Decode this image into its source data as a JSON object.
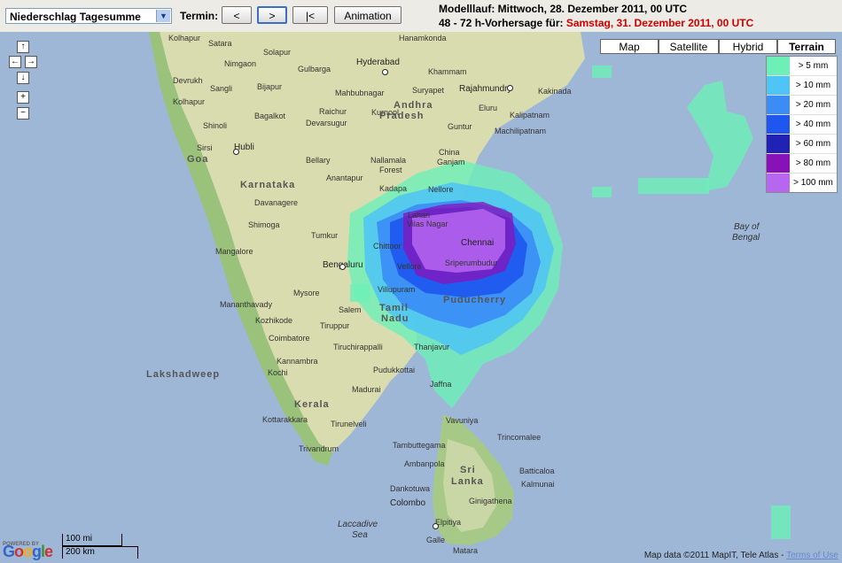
{
  "toolbar": {
    "product_select": "Niederschlag Tagesumme",
    "termin_label": "Termin:",
    "prev_btn": "<",
    "next_btn": ">",
    "first_btn": "|<",
    "animation_btn": "Animation"
  },
  "run_info": {
    "modelllauf": "Modelllauf: Mittwoch, 28. Dezember 2011, 00 UTC",
    "forecast_prefix": "48 - 72 h-Vorhersage für:",
    "forecast_time": "Samstag, 31. Dezember 2011, 00 UTC"
  },
  "map_types": [
    "Map",
    "Satellite",
    "Hybrid",
    "Terrain"
  ],
  "selected_map_type": "Terrain",
  "legend": [
    {
      "label": "> 5 mm",
      "color": "#6cf0b8"
    },
    {
      "label": "> 10 mm",
      "color": "#4fc4f7"
    },
    {
      "label": "> 20 mm",
      "color": "#3b8cf5"
    },
    {
      "label": "> 40 mm",
      "color": "#1e56f0"
    },
    {
      "label": "> 60 mm",
      "color": "#1f22b4"
    },
    {
      "label": "> 80 mm",
      "color": "#8812b8"
    },
    {
      "label": "> 100 mm",
      "color": "#b766f0"
    }
  ],
  "labels": {
    "kolhapur": "Kolhapur",
    "solapur": "Solapur",
    "gulbarga": "Gulbarga",
    "nimgaon": "Nimgaon",
    "satara": "Satara",
    "hyderabad": "Hyderabad",
    "hanamkonda": "Hanamkonda",
    "khammam": "Khammam",
    "devrukh": "Devrukh",
    "sangli": "Sangli",
    "bijapur": "Bijapur",
    "mahbubnagar": "Mahbubnagar",
    "suryapet": "Suryapet",
    "rajahmundry": "Rajahmundry",
    "kakinada": "Kakinada",
    "eluru": "Eluru",
    "bagalkot": "Bagalkot",
    "raichur": "Raichur",
    "devarsugur": "Devarsugur",
    "kurnool": "Kurnool",
    "andhra": "Andhra",
    "pradesh": "Pradesh",
    "kalipatnam": "Kalipatnam",
    "machilipatnam": "Machilipatnam",
    "guntur": "Guntur",
    "shinoli": "Shinoli",
    "hubli": "Hubli",
    "sirsi": "Sirsi",
    "goa": "Goa",
    "bellary": "Bellary",
    "nallamala": "Nallamala",
    "forest": "Forest",
    "china": "China",
    "ganjam": "Ganjam",
    "karnataka": "Karnataka",
    "anantapur": "Anantapur",
    "kadapa": "Kadapa",
    "nellore": "Nellore",
    "davanagere": "Davanagere",
    "shimoga": "Shimoga",
    "lahari": "Lahari",
    "vilas_nagar": "Vilas Nagar",
    "chennai": "Chennai",
    "tumkur": "Tumkur",
    "chittoor": "Chittoor",
    "mangalore": "Mangalore",
    "bengaluru": "Bengaluru",
    "vellore": "Vellore",
    "sriperumbudur": "Sriperumbudur",
    "bay_of": "Bay of",
    "bengal": "Bengal",
    "mysore": "Mysore",
    "villupuram": "Villupuram",
    "puducherry": "Puducherry",
    "mananthavady": "Mananthavady",
    "salem": "Salem",
    "tamil": "Tamil",
    "nadu": "Nadu",
    "kozhikode": "Kozhikode",
    "tiruppur": "Tiruppur",
    "coimbatore": "Coimbatore",
    "tiruchirappalli": "Tiruchirappalli",
    "thanjavur": "Thanjavur",
    "lakshadweep": "Lakshadweep",
    "kannambra": "Kannambra",
    "pudukkottai": "Pudukkottai",
    "kochi": "Kochi",
    "madurai": "Madurai",
    "jaffna": "Jaffna",
    "kerala": "Kerala",
    "kottarakkara": "Kottarakkara",
    "vavuniya": "Vavuniya",
    "tirunelveli": "Tirunelveli",
    "trincomalee": "Trincomalee",
    "trivandrum": "Trivandrum",
    "tambuttegama": "Tambuttegama",
    "sri": "Sri",
    "lanka": "Lanka",
    "ambanpola": "Ambanpola",
    "batticaloa": "Batticaloa",
    "kalmunai": "Kalmunai",
    "dankotuwa": "Dankotuwa",
    "colombo": "Colombo",
    "ginigathena": "Ginigathena",
    "laccadive": "Laccadive",
    "sea": "Sea",
    "elpitiya": "Elpitiya",
    "galle": "Galle",
    "matara": "Matara"
  },
  "footer": {
    "powered_by": "POWERED BY",
    "google": "Google",
    "scale_mi": "100 mi",
    "scale_km": "200 km",
    "copyright": "Map data ©2011 MapIT, Tele Atlas -",
    "terms": "Terms of Use"
  },
  "nav_icons": {
    "up": "↑",
    "left": "←",
    "right": "→",
    "down": "↓",
    "zoom_in": "+",
    "zoom_out": "−"
  }
}
